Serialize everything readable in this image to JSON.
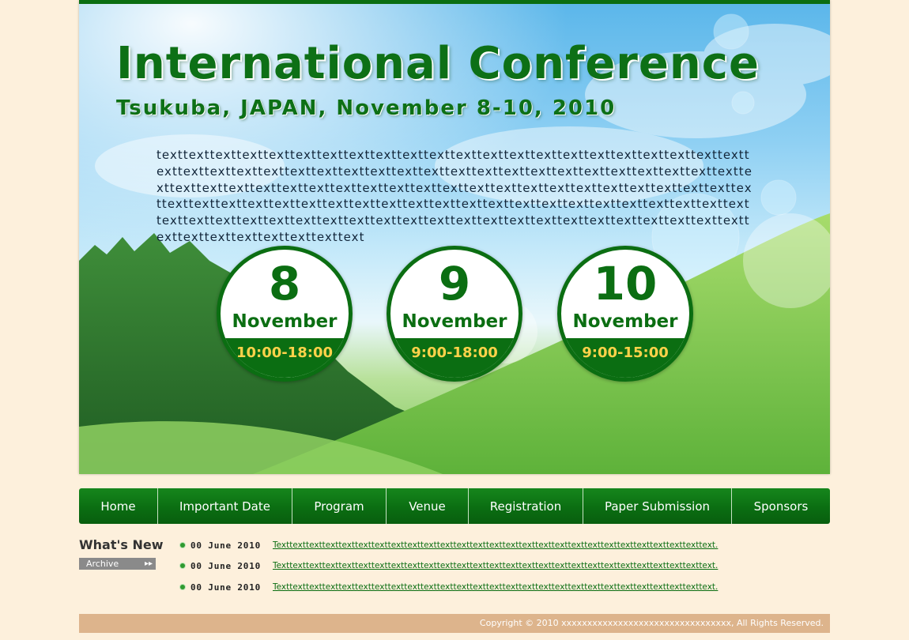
{
  "hero": {
    "title": "International Conference",
    "subtitle": "Tsukuba, JAPAN, November 8-10, 2010",
    "intro": "texttexttexttexttexttexttexttexttexttexttexttexttexttexttexttexttexttexttexttexttexttexttexttexttexttexttexttexttexttexttexttexttexttexttexttexttexttexttexttexttexttexttexttexttexttexttexttexttexttexttexttexttexttexttexttexttexttexttexttexttexttexttexttexttexttexttexttexttexttexttexttexttexttexttexttexttexttexttexttexttexttexttexttexttexttexttexttexttexttexttexttexttexttexttexttexttexttexttexttexttexttexttexttexttexttexttexttexttexttexttexttexttexttexttexttexttexttexttext",
    "days": [
      {
        "day": "8",
        "month": "November",
        "time": "10:00-18:00"
      },
      {
        "day": "9",
        "month": "November",
        "time": "9:00-18:00"
      },
      {
        "day": "10",
        "month": "November",
        "time": "9:00-15:00"
      }
    ]
  },
  "nav": {
    "items": [
      "Home",
      "Important Date",
      "Program",
      "Venue",
      "Registration",
      "Paper Submission",
      "Sponsors"
    ]
  },
  "news": {
    "title": "What's New",
    "archive_label": "Archive",
    "items": [
      {
        "date": "00 June 2010",
        "text": "Texttexttexttexttexttexttexttexttexttexttexttexttexttexttexttexttexttexttexttexttexttexttexttexttexttexttext."
      },
      {
        "date": "00 June 2010",
        "text": "Texttexttexttexttexttexttexttexttexttexttexttexttexttexttexttexttexttexttexttexttexttexttexttexttexttexttext."
      },
      {
        "date": "00 June 2010",
        "text": "Texttexttexttexttexttexttexttexttexttexttexttexttexttexttexttexttexttexttexttexttexttexttexttexttexttexttext."
      }
    ]
  },
  "footer": {
    "copyright": "Copyright © 2010 xxxxxxxxxxxxxxxxxxxxxxxxxxxxxxxxx, All Rights Reserved."
  },
  "colors": {
    "brand_green": "#0b6e12",
    "time_text": "#ffd24a",
    "page_background": "#fdf0dc",
    "footer_bar": "#ddb48c",
    "archive_button": "#8a8a8a"
  }
}
